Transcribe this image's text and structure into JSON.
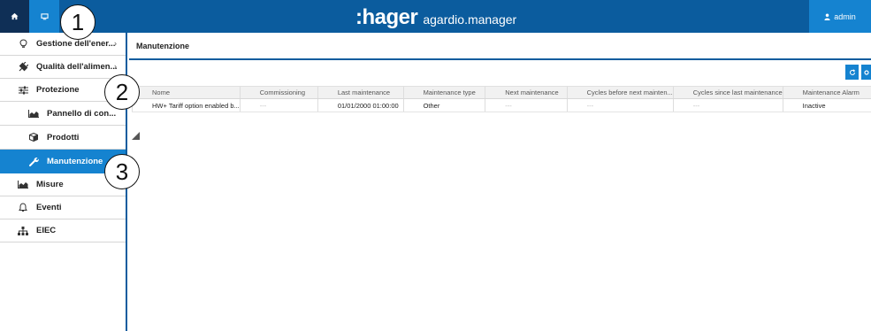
{
  "header": {
    "brand": ":hager",
    "product": "agardio.manager",
    "user_label": "admin",
    "icons": {
      "home": "home-icon",
      "monitor": "monitor-icon",
      "user": "user-icon"
    }
  },
  "sidebar": {
    "items": [
      {
        "label": "Gestione dell'ener...",
        "icon": "lightbulb-icon",
        "chevron": "›"
      },
      {
        "label": "Qualità dell'alimen...",
        "icon": "plug-icon",
        "chevron": "›"
      },
      {
        "label": "Protezione",
        "icon": "sliders-icon"
      },
      {
        "label": "Pannello di con...",
        "icon": "chart-icon"
      },
      {
        "label": "Prodotti",
        "icon": "box-icon"
      },
      {
        "label": "Manutenzione",
        "icon": "wrench-icon"
      },
      {
        "label": "Misure",
        "icon": "area-chart-icon",
        "chevron": "›"
      },
      {
        "label": "Eventi",
        "icon": "bell-icon"
      },
      {
        "label": "EIEC",
        "icon": "network-icon"
      }
    ]
  },
  "page": {
    "title": "Manutenzione"
  },
  "table": {
    "columns": [
      "Nome",
      "Commissioning",
      "Last maintenance",
      "Maintenance type",
      "Next maintenance",
      "Cycles before next mainten...",
      "Cycles since last maintenance",
      "Maintenance Alarm"
    ],
    "rows": [
      [
        "HW+ Tariff option enabled b...",
        "---",
        "01/01/2000 01:00:00",
        "Other",
        "---",
        "---",
        "---",
        "Inactive"
      ]
    ]
  },
  "callouts": [
    "1",
    "2",
    "3"
  ],
  "colors": {
    "topbar": "#0b5c9e",
    "accent": "#1583d0",
    "home": "#0f2f56"
  }
}
